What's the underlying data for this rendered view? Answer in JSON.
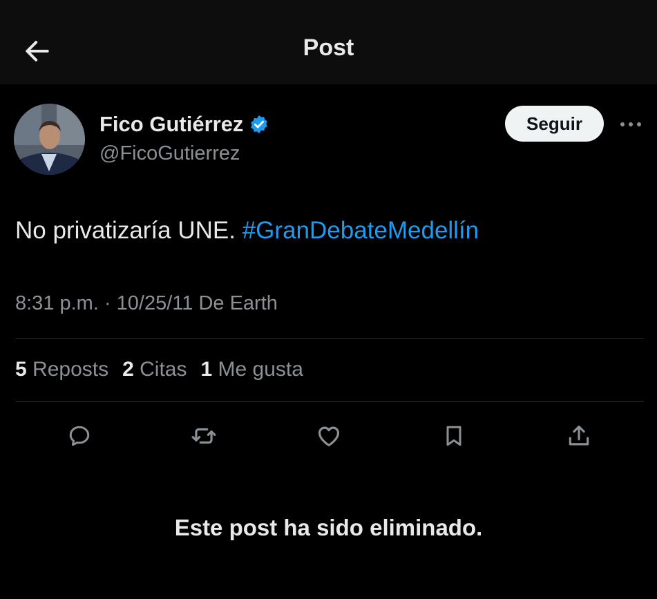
{
  "header": {
    "title": "Post",
    "back_icon": "arrow-left-icon"
  },
  "author": {
    "display_name": "Fico Gutiérrez",
    "handle": "@FicoGutierrez",
    "verified_icon": "verified-badge-icon",
    "avatar": "avatar-photo"
  },
  "follow_label": "Seguir",
  "more_icon": "more-horizontal-icon",
  "post": {
    "text": "No privatizaría UNE. ",
    "hashtag": "#GranDebateMedellín"
  },
  "meta": "8:31 p.m. · 10/25/11 De Earth",
  "stats": {
    "reposts_count": "5",
    "reposts_label": "Reposts",
    "quotes_count": "2",
    "quotes_label": "Citas",
    "likes_count": "1",
    "likes_label": "Me gusta"
  },
  "actions": [
    "reply-icon",
    "repost-icon",
    "like-icon",
    "bookmark-icon",
    "share-icon"
  ],
  "deleted_notice": "Este post ha sido eliminado.",
  "colors": {
    "background": "#000000",
    "header_background": "#0d0d0d",
    "accent": "#1d9bf0",
    "text_primary": "#e7e9ea",
    "text_secondary": "#8b9095"
  }
}
